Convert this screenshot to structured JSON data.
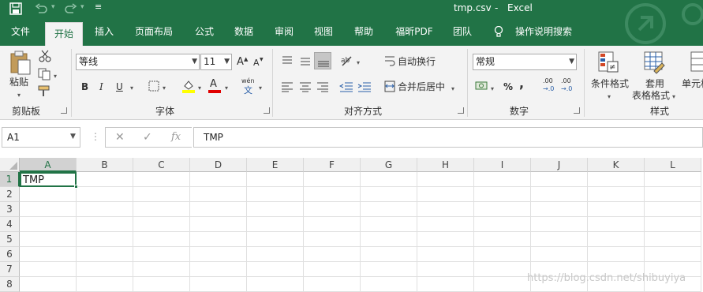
{
  "titlebar": {
    "title": "tmp.csv",
    "separator": "-",
    "app": "Excel"
  },
  "tabs": [
    "文件",
    "开始",
    "插入",
    "页面布局",
    "公式",
    "数据",
    "审阅",
    "视图",
    "帮助",
    "福昕PDF",
    "团队",
    "操作说明搜索"
  ],
  "ribbon": {
    "clipboard": {
      "paste": "粘贴",
      "group": "剪贴板"
    },
    "font": {
      "name": "等线",
      "size": "11",
      "bold": "B",
      "italic": "I",
      "underline": "U",
      "grow": "A",
      "shrink": "A",
      "fontcolor": "A",
      "phonetic_top": "wén",
      "phonetic_bottom": "文",
      "group": "字体"
    },
    "alignment": {
      "wrap": "自动换行",
      "merge": "合并后居中",
      "group": "对齐方式"
    },
    "number": {
      "format": "常规",
      "percent": "%",
      "comma": ",",
      "inc": ".00",
      "inc2": "→.0",
      "dec": ".00",
      "dec2": "→.0",
      "group": "数字"
    },
    "styles": {
      "conditional": "条件格式",
      "table_line1": "套用",
      "table_line2": "表格格式",
      "cell": "单元格",
      "group": "样式"
    }
  },
  "formula": {
    "namebox": "A1",
    "cancel": "✕",
    "enter": "✓",
    "fx": "fx",
    "value": "TMP"
  },
  "grid": {
    "columns": [
      "A",
      "B",
      "C",
      "D",
      "E",
      "F",
      "G",
      "H",
      "I",
      "J",
      "K",
      "L"
    ],
    "rows": [
      "1",
      "2",
      "3",
      "4",
      "5",
      "6",
      "7",
      "8"
    ],
    "a1": "TMP",
    "selected": "A1"
  },
  "watermark": "https://blog.csdn.net/shibuyiya",
  "colors": {
    "accent": "#217346",
    "ribbon_bg": "#f3f3f3"
  }
}
